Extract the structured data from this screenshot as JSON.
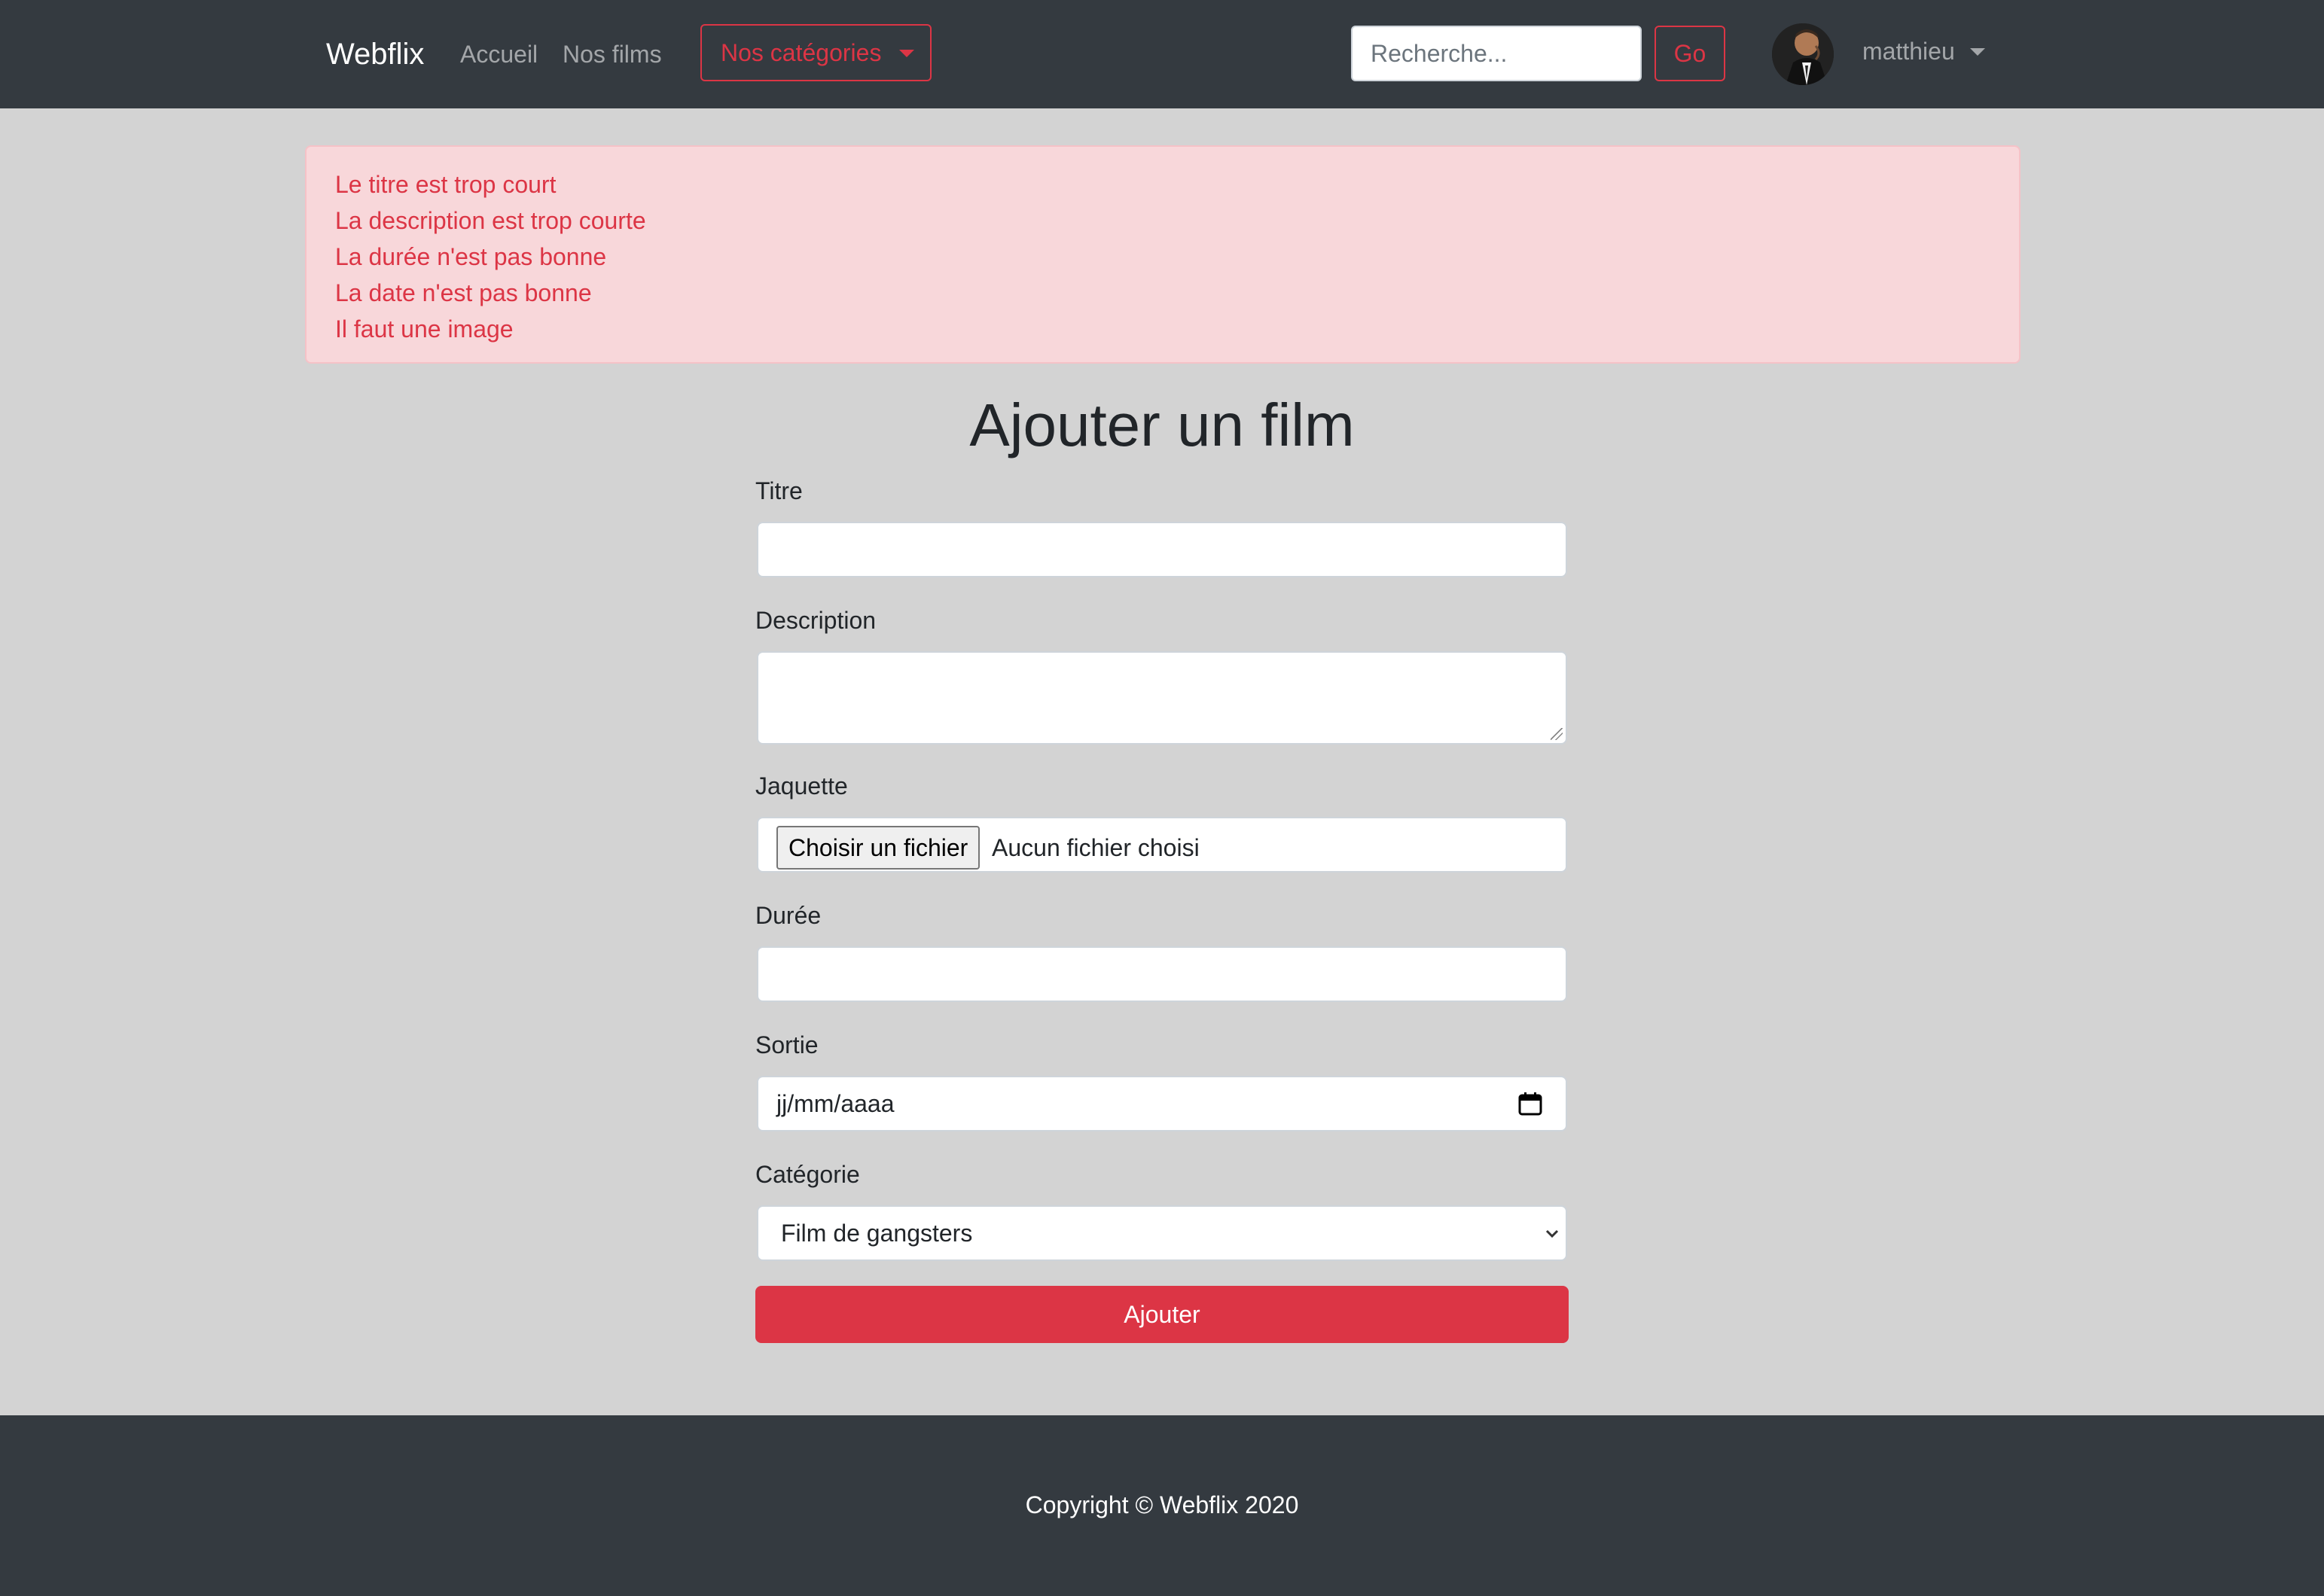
{
  "navbar": {
    "brand": "Webflix",
    "links": [
      "Accueil",
      "Nos films"
    ],
    "categories_label": "Nos catégories",
    "search_placeholder": "Recherche...",
    "search_button": "Go",
    "username": "matthieu"
  },
  "alert": {
    "messages": [
      "Le titre est trop court",
      "La description est trop courte",
      "La durée n'est pas bonne",
      "La date n'est pas bonne",
      "Il faut une image"
    ]
  },
  "form": {
    "title": "Ajouter un film",
    "titre_label": "Titre",
    "description_label": "Description",
    "jaquette_label": "Jaquette",
    "file_button": "Choisir un fichier",
    "file_status": "Aucun fichier choisi",
    "duree_label": "Durée",
    "sortie_label": "Sortie",
    "date_placeholder": "jj/mm/aaaa",
    "categorie_label": "Catégorie",
    "categorie_value": "Film de gangsters",
    "submit": "Ajouter"
  },
  "footer": {
    "copyright": "Copyright © Webflix 2020"
  },
  "colors": {
    "navbar_bg": "#343a40",
    "accent": "#dc3545",
    "alert_bg": "#f8d7da",
    "page_bg": "#d3d3d3"
  }
}
